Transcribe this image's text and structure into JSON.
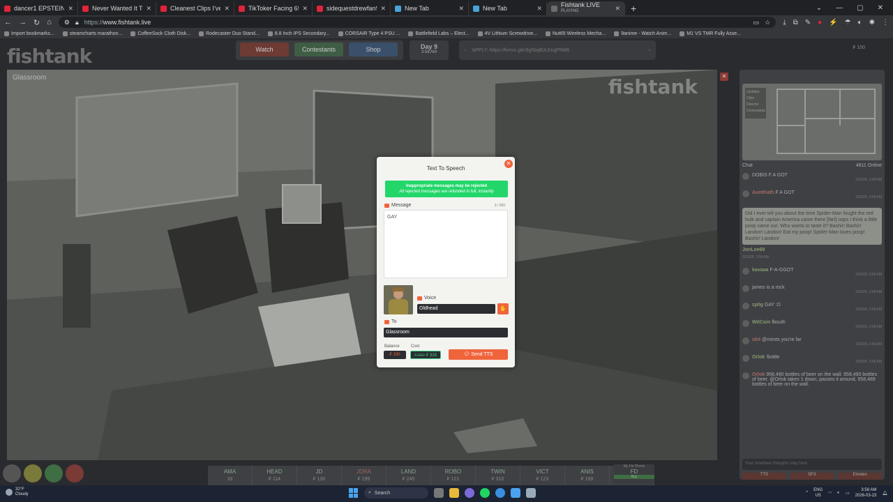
{
  "browser": {
    "tabs": [
      {
        "title": "dancer1 EPSTEIN ISLAND PART",
        "color": "#e0243a"
      },
      {
        "title": "Never Wanted It To End - YouT",
        "color": "#e0243a"
      },
      {
        "title": "Cleanest Clips I've Ever Hit...",
        "color": "#e0243a"
      },
      {
        "title": "TikToker Facing 65 years in Pri",
        "color": "#e0243a"
      },
      {
        "title": "sidequestdrewfan99 - YouTube",
        "color": "#e0243a"
      },
      {
        "title": "New Tab",
        "color": "#4aa3d8"
      },
      {
        "title": "New Tab",
        "color": "#4aa3d8"
      }
    ],
    "active_tab": {
      "title": "Fishtank LIVE",
      "subtitle": "PLAYING"
    },
    "url_prefix": "https://",
    "url_domain": "www.fishtank.live",
    "bookmarks": [
      "Import bookmarks...",
      "steamcharts marathon...",
      "CoffeeSock Cloth Disk...",
      "Rodecaster Duo Stand...",
      "8.8 Inch IPS Secondary...",
      "CORSAIR Type 4 PSU ...",
      "Battlefield Labs – Elect...",
      "4V Lithium Screwdrive...",
      "Nut65 Wireless Mecha...",
      "9anime - Watch Anim...",
      "M1 VS TMR Fully Asse..."
    ]
  },
  "site": {
    "logo": "fishtank",
    "nav": {
      "watch": "Watch",
      "contestants": "Contestants",
      "shop": "Shop"
    },
    "day": "Day 9",
    "time": "3:58 AM",
    "announcement": "APPLY: https://forms.gle/9g5bqf6XJrngFfN86",
    "balance_display": "₣ 100",
    "camera_label": "Glassroom",
    "watermark": "fishtank",
    "cam_close": "✕"
  },
  "sidebar": {
    "map_menu": [
      "Updates",
      "Clips",
      "Director",
      "Contestants"
    ],
    "chat_tab": "Chat",
    "online": "4811 Online",
    "messages": [
      {
        "user": "",
        "text": "DOBIS F A GOT",
        "time": "3/23/26, 3:58 AM"
      },
      {
        "user": "AuntKath",
        "text": "F A GOT",
        "time": "3/23/26, 3:58 AM",
        "red": true
      },
      {
        "user": "JonLee69",
        "text": "Did I ever tell you about the time Spider-Man fought the red hulk and captain America came there [fart] oops I think a little poop came out. Who wants to taste it? Bashir! Bashir! Landon! Landon! Eat my poop! Spider-Man loves poop! Bashir! Landon!",
        "time": "3/23/26, 3:58 AM",
        "bubble": true
      },
      {
        "user": "kavaaa",
        "text": "F-A-GGOT",
        "time": "3/23/26, 3:58 AM"
      },
      {
        "user": "",
        "text": "james is a rock",
        "time": "3/23/26, 3:58 AM",
        "red": true
      },
      {
        "user": "zp0g",
        "text": "GAY :D",
        "time": "3/23/26, 3:58 AM"
      },
      {
        "user": "WitCoin",
        "text": "fbouth",
        "time": "3/23/26, 3:58 AM"
      },
      {
        "user": "skit",
        "text": "@mimts you're far",
        "time": "3/23/26, 3:58 AM",
        "red": true
      },
      {
        "user": "Orlok",
        "text": "!bottle",
        "time": "3/23/26, 3:58 AM"
      },
      {
        "user": "Orlok",
        "text": "958,490 bottles of beer on the wall. 958,490 bottles of beer. @Orlok takes 1 down, passes it around, 958,489 bottles of beer on the wall.",
        "time": "",
        "red": true
      }
    ],
    "chat_placeholder": "Your unwritten thoughts stay here",
    "footer": [
      "TTS",
      "SFX",
      "Emotes"
    ]
  },
  "ticker": [
    {
      "name": "AMA",
      "value": "33"
    },
    {
      "name": "HEAD",
      "value": "₣ 114"
    },
    {
      "name": "JD",
      "value": "₣ 130"
    },
    {
      "name": "JDRA",
      "value": "₣ 199",
      "red": true
    },
    {
      "name": "LAND",
      "value": "₣ 240"
    },
    {
      "name": "ROBO",
      "value": "₣ 121"
    },
    {
      "name": "TWIN",
      "value": "₣ 310"
    },
    {
      "name": "VICT",
      "value": "₣ 123"
    },
    {
      "name": "ANIS",
      "value": "₣ 169"
    },
    {
      "name": "BASH",
      "value": "₣ 186"
    }
  ],
  "my_phone": {
    "label": "My Fin Phone",
    "value": "FD",
    "status": "Buy"
  },
  "tts": {
    "title": "Text To Speech",
    "close": "✕",
    "warn1": "Inappropriate messages may be rejected",
    "warn2": "All rejected messages are refunded in full, instantly",
    "message_label": "Message",
    "count": "3 / 250",
    "message": "GAY",
    "voice_label": "Voice",
    "voice": "Oldhead",
    "to_label": "To",
    "to": "Glassroom",
    "balance_label": "Balance",
    "balance": "₣ 100",
    "cost_label": "Cost",
    "cost_old": "₣ 350",
    "cost": "₣ 315",
    "send": "Send TTS"
  },
  "taskbar": {
    "temp": "32°F",
    "weather": "Cloudy",
    "search": "Search",
    "lang1": "ENG",
    "lang2": "US",
    "time": "3:58 AM",
    "date": "2026-03-23"
  }
}
